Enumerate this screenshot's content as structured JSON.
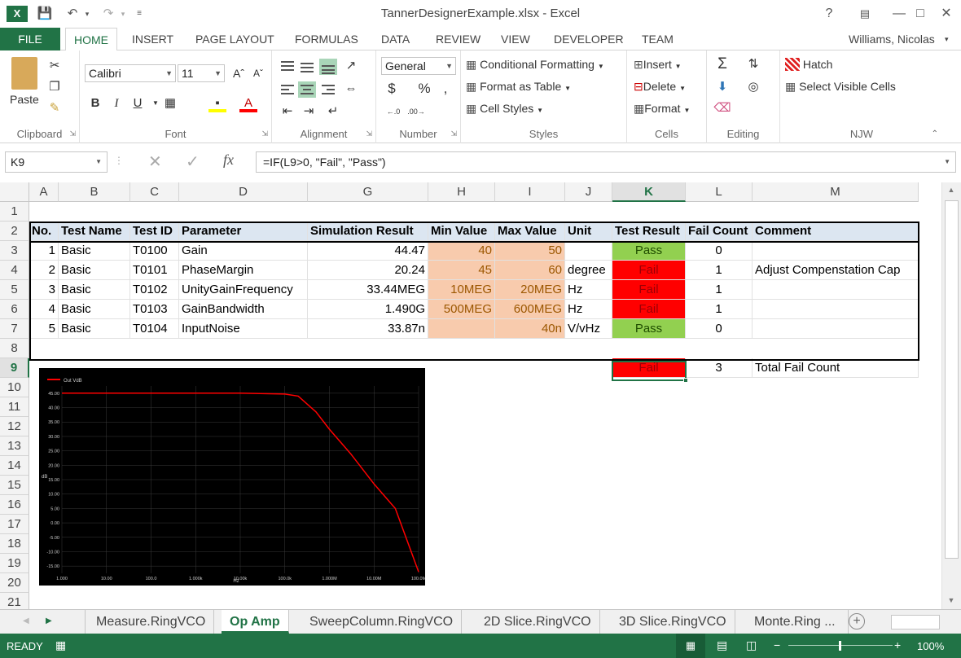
{
  "window": {
    "title": "TannerDesignerExample.xlsx - Excel",
    "user": "Williams, Nicolas"
  },
  "ribbon_tabs": [
    "FILE",
    "HOME",
    "INSERT",
    "PAGE LAYOUT",
    "FORMULAS",
    "DATA",
    "REVIEW",
    "VIEW",
    "DEVELOPER",
    "TEAM"
  ],
  "clipboard": {
    "paste": "Paste",
    "label": "Clipboard"
  },
  "font": {
    "name": "Calibri",
    "size": "11",
    "bold": "B",
    "italic": "I",
    "underline": "U",
    "label": "Font"
  },
  "alignment": {
    "label": "Alignment"
  },
  "number": {
    "format": "General",
    "currency": "$",
    "percent": "%",
    "comma": ",",
    "label": "Number"
  },
  "styles": {
    "conditional": "Conditional Formatting",
    "table": "Format as Table",
    "cell_styles": "Cell Styles",
    "label": "Styles"
  },
  "cells": {
    "insert": "Insert",
    "delete": "Delete",
    "format": "Format",
    "label": "Cells"
  },
  "editing": {
    "label": "Editing"
  },
  "njw": {
    "hatch": "Hatch",
    "select_visible": "Select Visible Cells",
    "label": "NJW"
  },
  "formula_bar": {
    "name_box": "K9",
    "formula": "=IF(L9>0, \"Fail\", \"Pass\")",
    "fx": "fx"
  },
  "columns": [
    "A",
    "B",
    "C",
    "D",
    "G",
    "H",
    "I",
    "J",
    "K",
    "L",
    "M"
  ],
  "rows": [
    "1",
    "2",
    "3",
    "4",
    "5",
    "6",
    "7",
    "8",
    "9",
    "10",
    "11",
    "12",
    "13",
    "14",
    "15",
    "16",
    "17",
    "18",
    "19",
    "20",
    "21"
  ],
  "table": {
    "headers": [
      "No.",
      "Test Name",
      "Test ID",
      "Parameter",
      "Simulation Result",
      "Min Value",
      "Max Value",
      "Unit",
      "Test Result",
      "Fail Count",
      "Comment"
    ],
    "rows": [
      [
        "1",
        "Basic",
        "T0100",
        "Gain",
        "44.47",
        "40",
        "50",
        "",
        "Pass",
        "0",
        ""
      ],
      [
        "2",
        "Basic",
        "T0101",
        "PhaseMargin",
        "20.24",
        "45",
        "60",
        "degree",
        "Fail",
        "1",
        "Adjust Compenstation Cap"
      ],
      [
        "3",
        "Basic",
        "T0102",
        "UnityGainFrequency",
        "33.44MEG",
        "10MEG",
        "20MEG",
        "Hz",
        "Fail",
        "1",
        ""
      ],
      [
        "4",
        "Basic",
        "T0103",
        "GainBandwidth",
        "1.490G",
        "500MEG",
        "600MEG",
        "Hz",
        "Fail",
        "1",
        ""
      ],
      [
        "5",
        "Basic",
        "T0104",
        "InputNoise",
        "33.87n",
        "",
        "40n",
        "V/vHz",
        "Pass",
        "0",
        ""
      ]
    ],
    "total": {
      "result": "Fail",
      "count": "3",
      "comment": "Total Fail Count"
    }
  },
  "chart_data": {
    "type": "line",
    "series": [
      {
        "name": "Out VdB",
        "x": [
          1,
          10,
          100,
          1000,
          10000,
          100000,
          200000,
          500000,
          1000000,
          3000000,
          10000000,
          30000000,
          100000000
        ],
        "values": [
          45.0,
          45.0,
          45.0,
          45.0,
          45.0,
          44.7,
          44.0,
          38.5,
          32.5,
          24.0,
          13.5,
          5.0,
          -17.0
        ]
      }
    ],
    "x_scale": "log",
    "xlim": [
      1,
      100000000
    ],
    "ylim": [
      -17.5,
      47.5
    ],
    "x_ticks": [
      "1.000",
      "10.00",
      "100.0",
      "1.000k",
      "10.00k",
      "100.0k",
      "1.000M",
      "10.00M",
      "100.0M"
    ],
    "y_ticks": [
      "45.00",
      "40.00",
      "35.00",
      "30.00",
      "25.00",
      "20.00",
      "15.00",
      "10.00",
      "5.00",
      "0.00",
      "-5.00",
      "-10.00",
      "-15.00"
    ],
    "xlabel": "Hz",
    "ylabel": "dB",
    "colors": {
      "line": "#ff0000",
      "background": "#000000"
    }
  },
  "sheet_tabs": [
    "Measure.RingVCO",
    "Op Amp",
    "SweepColumn.RingVCO",
    "2D Slice.RingVCO",
    "3D Slice.RingVCO",
    "Monte.Ring ..."
  ],
  "status": {
    "ready": "READY",
    "zoom": "100%"
  }
}
